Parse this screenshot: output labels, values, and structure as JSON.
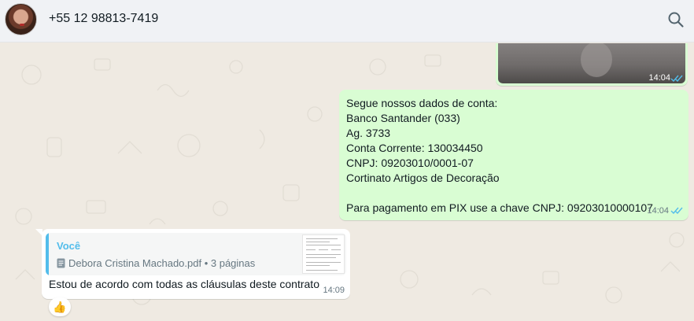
{
  "header": {
    "contact_name": "+55 12 98813-7419",
    "avatar_icon": "avatar-photo",
    "search_icon": "search-icon"
  },
  "messages": {
    "image_message": {
      "time": "14:04",
      "status": "read",
      "tick_color": "#53bdeb"
    },
    "bank_message": {
      "lines": [
        "Segue nossos dados de conta:",
        "Banco Santander (033)",
        "Ag. 3733",
        "Conta Corrente: 130034450",
        "CNPJ: 09203010/0001-07",
        "Cortinato Artigos de Decoração",
        "",
        "Para pagamento em PIX use a chave CNPJ: 09203010000107"
      ],
      "time": "14:04",
      "status": "read"
    },
    "incoming_message": {
      "quote": {
        "author": "Você",
        "document_name": "Debora Cristina Machado.pdf",
        "document_pages": "3 páginas",
        "document_icon": "document-icon"
      },
      "text": "Estou de acordo com todas as cláusulas deste contrato",
      "time": "14:09",
      "reaction": "👍"
    }
  },
  "colors": {
    "outgoing_bubble": "#d9fdd3",
    "incoming_bubble": "#ffffff",
    "chat_background": "#efeae2",
    "accent_blue": "#53bdeb"
  }
}
